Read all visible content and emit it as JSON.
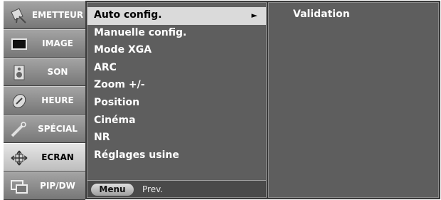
{
  "tabs": [
    {
      "label": "EMETTEUR",
      "icon": "antenna-icon"
    },
    {
      "label": "IMAGE",
      "icon": "monitor-icon"
    },
    {
      "label": "SON",
      "icon": "speaker-icon"
    },
    {
      "label": "HEURE",
      "icon": "clock-icon"
    },
    {
      "label": "SPÉCIAL",
      "icon": "special-icon"
    },
    {
      "label": "ECRAN",
      "icon": "screen-adjust-icon",
      "active": true
    },
    {
      "label": "PIP/DW",
      "icon": "pip-icon"
    }
  ],
  "menu": {
    "items": [
      {
        "label": "Auto config.",
        "selected": true,
        "arrow": "►"
      },
      {
        "label": "Manuelle config."
      },
      {
        "label": "Mode XGA"
      },
      {
        "label": "ARC"
      },
      {
        "label": "Zoom +/-"
      },
      {
        "label": "Position"
      },
      {
        "label": "Cinéma"
      },
      {
        "label": "NR"
      },
      {
        "label": "Réglages usine"
      }
    ],
    "menu_button": "Menu",
    "prev_label": "Prev."
  },
  "right": {
    "text": "Validation"
  },
  "colors": {
    "panel": "#5e5e5e",
    "highlight": "#dadada",
    "tab": "#8c8c8c"
  }
}
